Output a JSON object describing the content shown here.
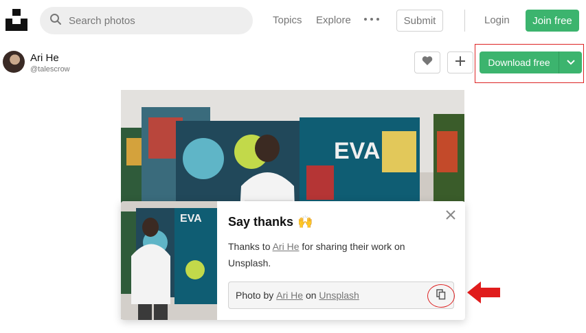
{
  "header": {
    "search_placeholder": "Search photos",
    "nav": {
      "topics": "Topics",
      "explore": "Explore"
    },
    "submit_label": "Submit",
    "login_label": "Login",
    "join_label": "Join free"
  },
  "author": {
    "name": "Ari He",
    "handle": "@talescrow"
  },
  "actions": {
    "download_label": "Download free"
  },
  "popup": {
    "title": "Say thanks",
    "emoji": "🙌",
    "text_prefix": "Thanks to ",
    "author_link": "Ari He",
    "text_suffix": " for sharing their work on Unsplash.",
    "credit_prefix": "Photo by ",
    "credit_author": "Ari He",
    "credit_middle": " on ",
    "credit_site": "Unsplash"
  },
  "colors": {
    "brand_green": "#3cb46e",
    "annotation_red": "#dd2222",
    "text_muted": "#767676"
  },
  "icons": [
    "unsplash-logo",
    "search-icon",
    "more-icon",
    "heart-icon",
    "plus-icon",
    "chevron-down-icon",
    "close-icon",
    "copy-icon",
    "arrow-annotation"
  ]
}
